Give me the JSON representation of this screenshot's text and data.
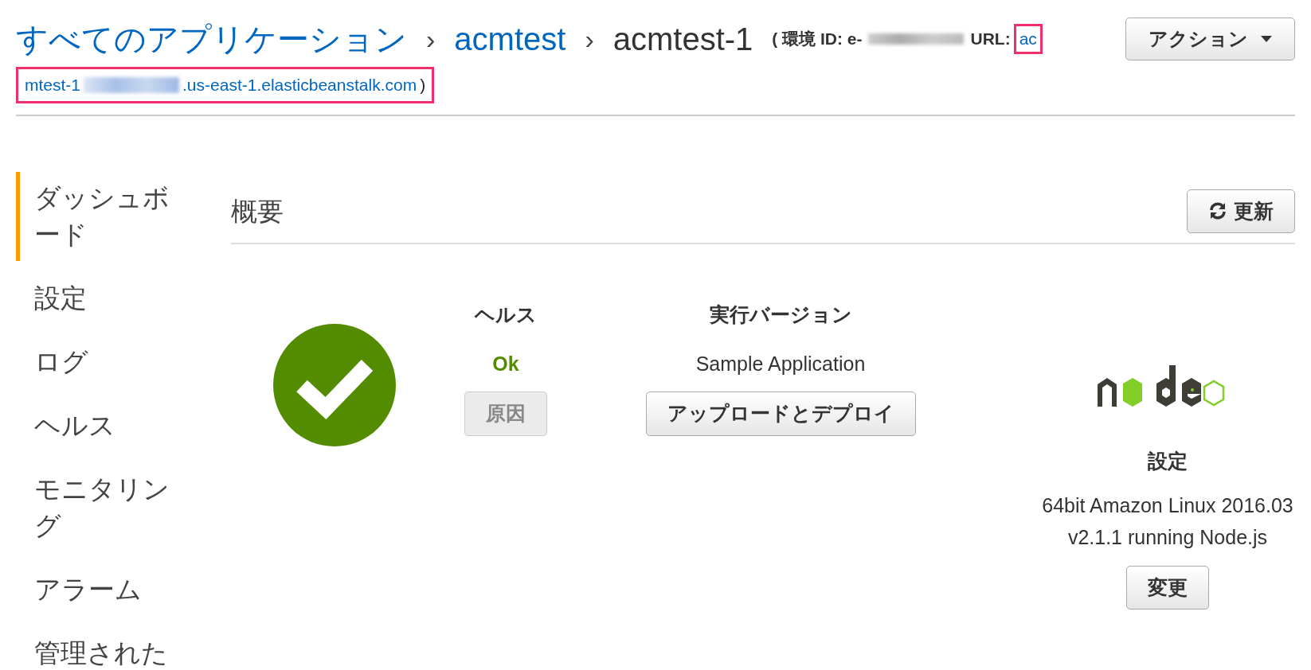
{
  "breadcrumb": [
    {
      "label": "すべてのアプリケーション",
      "link": true
    },
    {
      "label": "acmtest",
      "link": true
    },
    {
      "label": "acmtest-1",
      "link": false
    }
  ],
  "separators": [
    "›",
    "›"
  ],
  "env_info": {
    "open": "(",
    "id_label": "環境 ID: e-",
    "url_label": "URL:",
    "url_start": "ac",
    "url_rest": "mtest-1",
    "url_domain": ".us-east-1.elasticbeanstalk.com",
    "close": ")"
  },
  "actions_button": {
    "label": "アクション"
  },
  "sidebar": {
    "items": [
      {
        "label": "ダッシュボード",
        "selected": true
      },
      {
        "label": "設定",
        "selected": false
      },
      {
        "label": "ログ",
        "selected": false
      },
      {
        "label": "ヘルス",
        "selected": false
      },
      {
        "label": "モニタリング",
        "selected": false
      },
      {
        "label": "アラーム",
        "selected": false
      },
      {
        "label": "管理された",
        "selected": false
      }
    ]
  },
  "overview": {
    "title": "概要",
    "refresh_button": "更新"
  },
  "health": {
    "heading": "ヘルス",
    "status": "Ok",
    "cause_button": {
      "label": "原因",
      "disabled": true
    }
  },
  "version": {
    "heading": "実行バージョン",
    "value": "Sample Application",
    "button": {
      "label": "アップロードとデプロイ",
      "disabled": false
    }
  },
  "platform": {
    "heading": "設定",
    "lines": [
      "64bit Amazon Linux 2016.03",
      "v2.1.1 running Node.js"
    ],
    "button": {
      "label": "変更",
      "disabled": false
    }
  }
}
